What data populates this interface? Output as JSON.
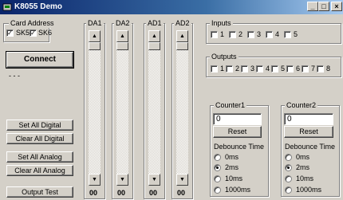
{
  "window": {
    "title": "K8055 Demo",
    "minimize": "_",
    "maximize": "□",
    "close": "×"
  },
  "card_address": {
    "label": "Card Address",
    "sk5": {
      "label": "SK5",
      "checked": true
    },
    "sk6": {
      "label": "SK6",
      "checked": true
    }
  },
  "connect": {
    "label": "Connect",
    "status": "- - -"
  },
  "buttons": {
    "set_all_digital": "Set All Digital",
    "clear_all_digital": "Clear All Digital",
    "set_all_analog": "Set All Analog",
    "clear_all_analog": "Clear All Analog",
    "output_test": "Output Test"
  },
  "channels": [
    {
      "label": "DA1",
      "value": "00"
    },
    {
      "label": "DA2",
      "value": "00"
    },
    {
      "label": "AD1",
      "value": "00"
    },
    {
      "label": "AD2",
      "value": "00"
    }
  ],
  "inputs": {
    "label": "Inputs",
    "items": [
      "1",
      "2",
      "3",
      "4",
      "5"
    ]
  },
  "outputs": {
    "label": "Outputs",
    "items": [
      "1",
      "2",
      "3",
      "4",
      "5",
      "6",
      "7",
      "8"
    ]
  },
  "counters": [
    {
      "label": "Counter1",
      "value": "0",
      "reset": "Reset",
      "debounce_label": "Debounce Time",
      "options": [
        {
          "label": "0ms",
          "selected": false
        },
        {
          "label": "2ms",
          "selected": true
        },
        {
          "label": "10ms",
          "selected": false
        },
        {
          "label": "1000ms",
          "selected": false
        }
      ]
    },
    {
      "label": "Counter2",
      "value": "0",
      "reset": "Reset",
      "debounce_label": "Debounce Time",
      "options": [
        {
          "label": "0ms",
          "selected": false
        },
        {
          "label": "2ms",
          "selected": true
        },
        {
          "label": "10ms",
          "selected": false
        },
        {
          "label": "1000ms",
          "selected": false
        }
      ]
    }
  ]
}
